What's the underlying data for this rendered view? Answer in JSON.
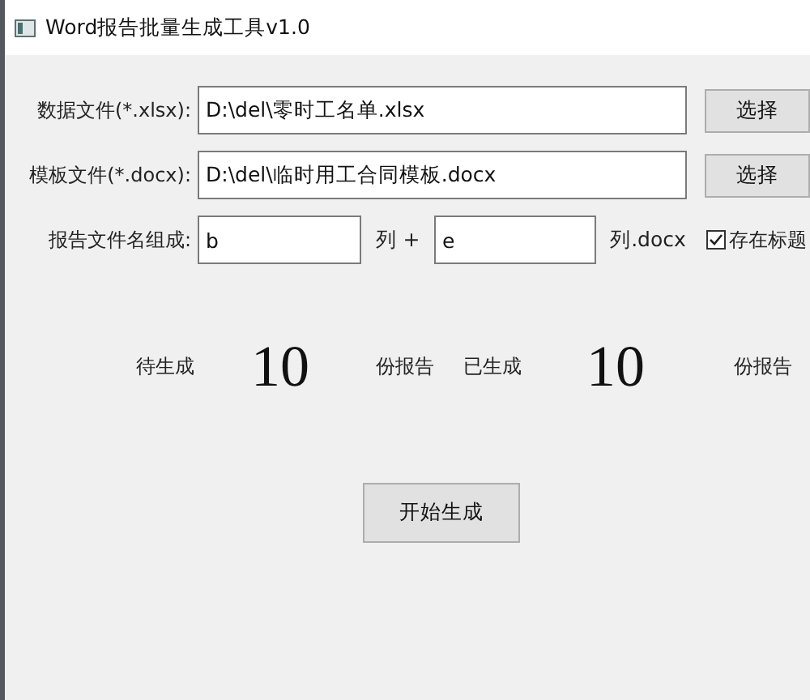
{
  "window": {
    "title": "Word报告批量生成工具v1.0"
  },
  "file_rows": [
    {
      "label": "数据文件(*.xlsx):",
      "value": "D:\\del\\零时工名单.xlsx",
      "button": "选择"
    },
    {
      "label": "模板文件(*.docx):",
      "value": "D:\\del\\临时用工合同模板.docx",
      "button": "选择"
    }
  ],
  "name_row": {
    "label": "报告文件名组成:",
    "first_column": "b",
    "first_suffix": "列 +",
    "second_column": "e",
    "second_suffix": "列.docx",
    "header_checkbox": {
      "label": "存在标题",
      "checked": true
    }
  },
  "counts": [
    {
      "label": "待生成",
      "value": "10",
      "unit": "份报告"
    },
    {
      "label": "已生成",
      "value": "10",
      "unit": "份报告"
    }
  ],
  "start_button": "开始生成"
}
